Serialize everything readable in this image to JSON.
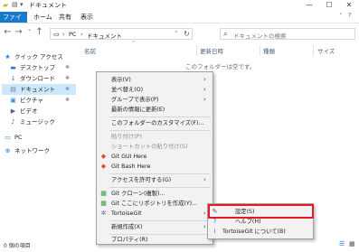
{
  "window": {
    "title": "ドキュメント",
    "minimize": "—",
    "maximize": "☐",
    "close": "✕"
  },
  "ribbon": {
    "tabs": [
      "ファイル",
      "ホーム",
      "共有",
      "表示"
    ]
  },
  "address": {
    "back": "←",
    "forward": "→",
    "up_dropdown": "˅",
    "up": "↑",
    "crumbs": [
      "PC",
      "ドキュメント"
    ],
    "sep": "›",
    "search_placeholder": "ドキュメントの検索"
  },
  "sidebar": {
    "items": [
      {
        "label": "クイック アクセス",
        "icon": "star-icon",
        "glyph": "★"
      },
      {
        "label": "デスクトップ",
        "icon": "desktop-icon",
        "glyph": "▬",
        "pinned": true
      },
      {
        "label": "ダウンロード",
        "icon": "download-icon",
        "glyph": "↓",
        "pinned": true
      },
      {
        "label": "ドキュメント",
        "icon": "document-icon",
        "glyph": "▤",
        "pinned": true,
        "selected": true
      },
      {
        "label": "ピクチャ",
        "icon": "picture-icon",
        "glyph": "▣",
        "pinned": true
      },
      {
        "label": "ビデオ",
        "icon": "video-icon",
        "glyph": "▶"
      },
      {
        "label": "ミュージック",
        "icon": "music-icon",
        "glyph": "♪"
      },
      {
        "label": "PC",
        "icon": "pc-icon",
        "glyph": "▭"
      },
      {
        "label": "ネットワーク",
        "icon": "network-icon",
        "glyph": "⊕"
      }
    ],
    "pin_glyph": "✱"
  },
  "columns": {
    "name": "名前",
    "date": "更新日時",
    "type": "種類",
    "size": "サイズ",
    "sort_glyph": "˄"
  },
  "empty_text": "このフォルダーは空です。",
  "context_menu": {
    "items": [
      {
        "label": "表示(V)",
        "arrow": true
      },
      {
        "label": "並べ替え(O)",
        "arrow": true
      },
      {
        "label": "グループで表示(P)",
        "arrow": true
      },
      {
        "label": "最新の情報に更新(E)"
      },
      {
        "sep": true
      },
      {
        "label": "このフォルダーのカスタマイズ(F)..."
      },
      {
        "sep": true
      },
      {
        "label": "貼り付け(P)",
        "disabled": true
      },
      {
        "label": "ショートカットの貼り付け(S)",
        "disabled": true
      },
      {
        "label": "Git GUI Here",
        "icon": "git-gui-icon",
        "glyph": "◆"
      },
      {
        "label": "Git Bash Here",
        "icon": "git-bash-icon",
        "glyph": "◆"
      },
      {
        "sep": true
      },
      {
        "label": "アクセスを許可する(G)",
        "arrow": true
      },
      {
        "sep": true
      },
      {
        "label": "Git クローン(複製)...",
        "icon": "git-clone-icon",
        "glyph": "▦"
      },
      {
        "label": "Git ここにリポジトリを作成(Y)...",
        "icon": "git-create-repo-icon",
        "glyph": "▦"
      },
      {
        "label": "TortoiseGit",
        "icon": "tortoisegit-icon",
        "glyph": "✲",
        "arrow": true
      },
      {
        "sep": true
      },
      {
        "label": "新規作成(X)",
        "arrow": true
      },
      {
        "sep": true
      },
      {
        "label": "プロパティ(R)"
      }
    ],
    "arrow_glyph": "›"
  },
  "submenu": {
    "items": [
      {
        "label": "設定(S)",
        "icon": "settings-wrench-icon",
        "glyph": "✎"
      },
      {
        "label": "ヘルプ(H)",
        "icon": "help-icon",
        "glyph": "?"
      },
      {
        "label": "TortoiseGit について(B)",
        "icon": "info-icon",
        "glyph": "i"
      }
    ]
  },
  "status": {
    "count": "0 個の項目"
  },
  "view_toggles": {
    "details": "☰",
    "tiles": "▦"
  }
}
